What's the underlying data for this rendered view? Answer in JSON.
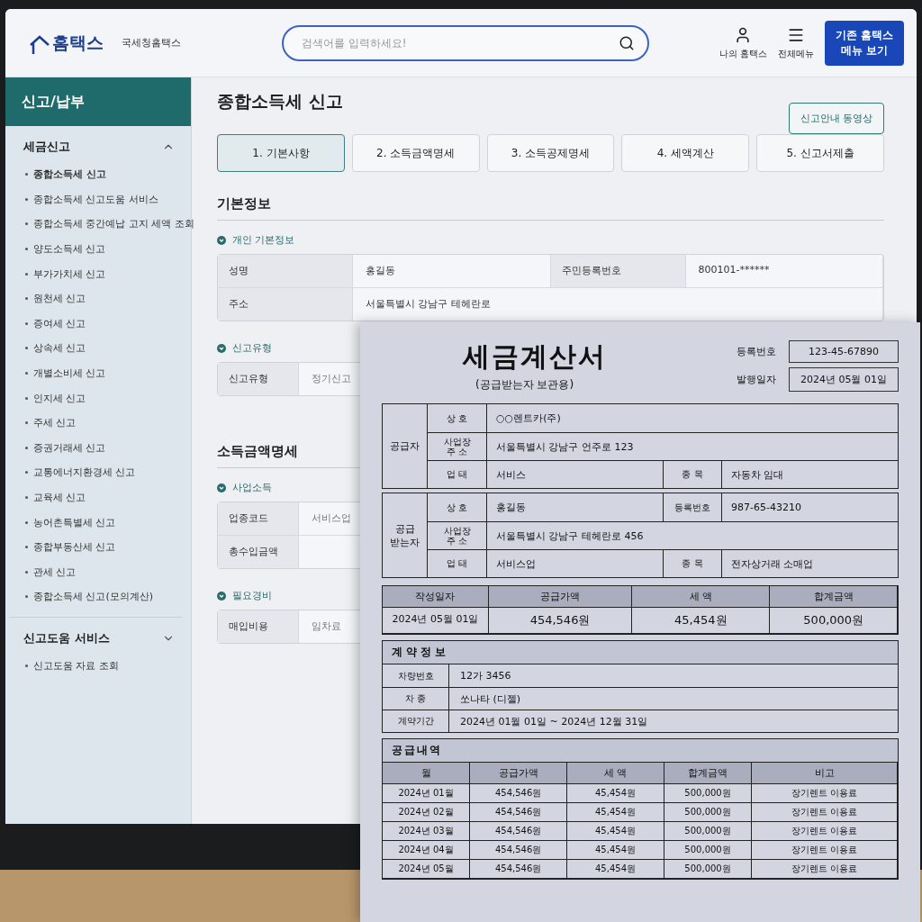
{
  "header": {
    "logo_text": "홈택스",
    "logo_subtitle": "국세청홈택스",
    "search": {
      "placeholder": "검색어를 입력하세요!"
    },
    "nav": [
      {
        "kind": "user",
        "label": "나의 홈택스"
      },
      {
        "kind": "menu",
        "label": "전체메뉴"
      }
    ],
    "legacy_button": "기존 홈택스 메뉴 보기"
  },
  "sidebar": {
    "title": "신고/납부",
    "sections": [
      {
        "title": "세금신고",
        "expanded": true,
        "items": [
          {
            "label": "종합소득세 신고",
            "selected": true
          },
          {
            "label": "종합소득세 신고도움 서비스",
            "selected": false
          },
          {
            "label": "종합소득세 중간예납 고지 세액 조회",
            "selected": false
          },
          {
            "label": "양도소득세 신고",
            "selected": false
          },
          {
            "label": "부가가치세 신고",
            "selected": false
          },
          {
            "label": "원천세 신고",
            "selected": false
          },
          {
            "label": "증여세 신고",
            "selected": false
          },
          {
            "label": "상속세 신고",
            "selected": false
          },
          {
            "label": "개별소비세 신고",
            "selected": false
          },
          {
            "label": "인지세 신고",
            "selected": false
          },
          {
            "label": "주세 신고",
            "selected": false
          },
          {
            "label": "증권거래세 신고",
            "selected": false
          },
          {
            "label": "교통에너지환경세 신고",
            "selected": false
          },
          {
            "label": "교육세 신고",
            "selected": false
          },
          {
            "label": "농어촌특별세 신고",
            "selected": false
          },
          {
            "label": "종합부동산세 신고",
            "selected": false
          },
          {
            "label": "관세 신고",
            "selected": false
          },
          {
            "label": "종합소득세 신고(모의계산)",
            "selected": false
          }
        ]
      },
      {
        "title": "신고도움 서비스",
        "expanded": false,
        "items": [
          {
            "label": "신고도움 자료 조회",
            "selected": false
          }
        ]
      }
    ]
  },
  "page": {
    "title": "종합소득세 신고",
    "video_button": "신고안내 동영상",
    "steps": [
      {
        "label": "1. 기본사항",
        "selected": true
      },
      {
        "label": "2. 소득금액명세",
        "selected": false
      },
      {
        "label": "3. 소득공제명세",
        "selected": false
      },
      {
        "label": "4. 세액계산",
        "selected": false
      },
      {
        "label": "5. 신고서제출",
        "selected": false
      }
    ],
    "sections": [
      {
        "heading": "기본정보",
        "groups": [
          {
            "title": "개인 기본정보",
            "rows": [
              [
                {
                  "label": "성명",
                  "value": "홍길동"
                },
                {
                  "label": "주민등록번호",
                  "value": "800101-******"
                }
              ],
              [
                {
                  "label": "주소",
                  "value": "서울특별시 강남구 테헤란로"
                }
              ]
            ]
          },
          {
            "title": "신고유형",
            "rows": [
              [
                {
                  "label": "신고유형",
                  "value": "정기신고"
                }
              ]
            ]
          }
        ]
      },
      {
        "heading": "소득금액명세",
        "groups": [
          {
            "title": "사업소득",
            "rows": [
              [
                {
                  "label": "업종코드",
                  "value": "서비스업"
                }
              ],
              [
                {
                  "label": "총수입금액"
                }
              ]
            ]
          },
          {
            "title": "필요경비",
            "rows": [
              [
                {
                  "label": "매입비용",
                  "value": "임차료"
                }
              ]
            ]
          }
        ]
      }
    ]
  },
  "document": {
    "title": "세금계산서",
    "subtitle": "(공급받는자 보관용)",
    "meta": [
      {
        "label": "등록번호",
        "value": "123-45-67890"
      },
      {
        "label": "발행일자",
        "value": "2024년 05월 01일"
      }
    ],
    "parties": [
      {
        "title": "공급자",
        "rows": [
          [
            {
              "kind": "label",
              "text": "상 호"
            },
            {
              "kind": "value",
              "text": "○○렌트카(주)"
            }
          ],
          [
            {
              "kind": "label",
              "text": "사업장\n주 소"
            },
            {
              "kind": "value",
              "text": "서울특별시 강남구 언주로 123"
            }
          ],
          [
            {
              "kind": "label",
              "text": "업 태"
            },
            {
              "kind": "value",
              "text": "서비스"
            },
            {
              "kind": "label",
              "text": "종 목"
            },
            {
              "kind": "value",
              "text": "자동차 임대"
            }
          ]
        ]
      },
      {
        "title": "공급\n받는자",
        "rows": [
          [
            {
              "kind": "label",
              "text": "상 호"
            },
            {
              "kind": "value",
              "text": "홍길동"
            },
            {
              "kind": "label",
              "text": "등록번호"
            },
            {
              "kind": "value",
              "text": "987-65-43210"
            }
          ],
          [
            {
              "kind": "label",
              "text": "사업장\n주 소"
            },
            {
              "kind": "value",
              "text": "서울특별시 강남구 테헤란로 456"
            }
          ],
          [
            {
              "kind": "label",
              "text": "업 태"
            },
            {
              "kind": "value",
              "text": "서비스업"
            },
            {
              "kind": "label",
              "text": "종 목"
            },
            {
              "kind": "value",
              "text": "전자상거래 소매업"
            }
          ]
        ]
      }
    ],
    "totals": {
      "columns": [
        "작성일자",
        "공급가액",
        "세 액",
        "합계금액"
      ],
      "values": [
        "2024년 05월 01일",
        "454,546원",
        "45,454원",
        "500,000원"
      ]
    },
    "contract": {
      "heading": "계약정보",
      "rows": [
        {
          "label": "차량번호",
          "value": "12가 3456"
        },
        {
          "label": "차 종",
          "value": "쏘나타 (디젤)"
        },
        {
          "label": "계약기간",
          "value": "2024년 01월 01일 ~ 2024년 12월 31일"
        }
      ]
    },
    "supply": {
      "heading": "공급내역",
      "columns": [
        "월",
        "공급가액",
        "세 액",
        "합계금액",
        "비고"
      ],
      "rows": [
        [
          "2024년 01월",
          "454,546원",
          "45,454원",
          "500,000원",
          "장기렌트 이용료"
        ],
        [
          "2024년 02월",
          "454,546원",
          "45,454원",
          "500,000원",
          "장기렌트 이용료"
        ],
        [
          "2024년 03월",
          "454,546원",
          "45,454원",
          "500,000원",
          "장기렌트 이용료"
        ],
        [
          "2024년 04월",
          "454,546원",
          "45,454원",
          "500,000원",
          "장기렌트 이용료"
        ],
        [
          "2024년 05월",
          "454,546원",
          "45,454원",
          "500,000원",
          "장기렌트 이용료"
        ]
      ]
    }
  }
}
